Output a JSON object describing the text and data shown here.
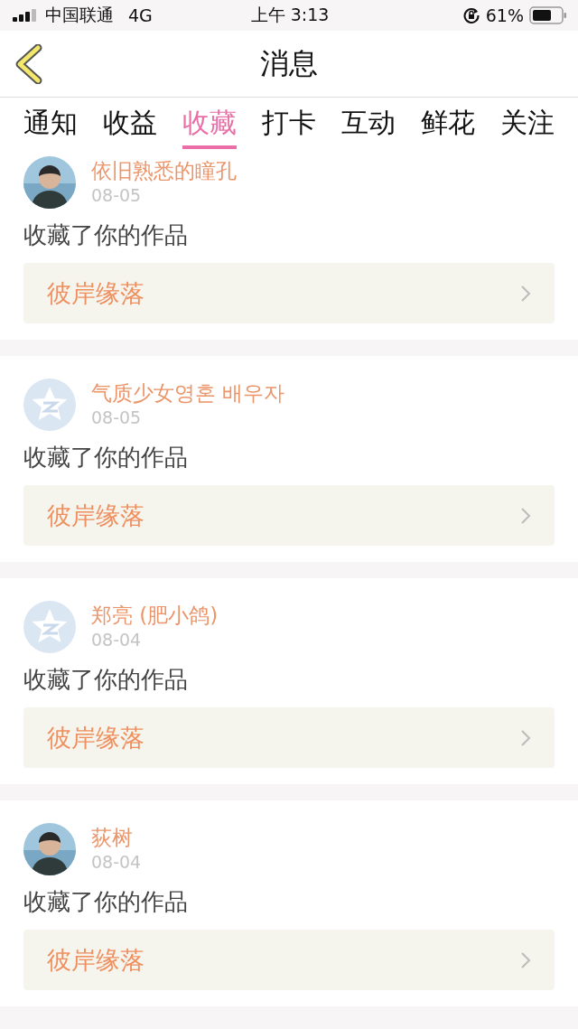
{
  "status_bar": {
    "carrier": "中国联通",
    "network": "4G",
    "time": "上午 3:13",
    "battery": "61%"
  },
  "nav": {
    "title": "消息"
  },
  "tabs": [
    {
      "label": "通知",
      "selected": false
    },
    {
      "label": "收益",
      "selected": false
    },
    {
      "label": "收藏",
      "selected": true
    },
    {
      "label": "打卡",
      "selected": false
    },
    {
      "label": "互动",
      "selected": false
    },
    {
      "label": "鲜花",
      "selected": false
    },
    {
      "label": "关注",
      "selected": false
    }
  ],
  "messages": [
    {
      "kind": "picture",
      "name": "依旧熟悉的瞳孔",
      "date": "08-05",
      "text": "收藏了你的作品",
      "work": "彼岸缘落"
    },
    {
      "kind": "default-avatar",
      "name": "气质少女영혼 배우자",
      "date": "08-05",
      "text": "收藏了你的作品",
      "work": "彼岸缘落"
    },
    {
      "kind": "default-avatar",
      "name": "郑亮 (肥小鸽)",
      "date": "08-04",
      "text": "收藏了你的作品",
      "work": "彼岸缘落"
    },
    {
      "kind": "picture",
      "name": "荻树",
      "date": "08-04",
      "text": "收藏了你的作品",
      "work": "彼岸缘落"
    }
  ]
}
